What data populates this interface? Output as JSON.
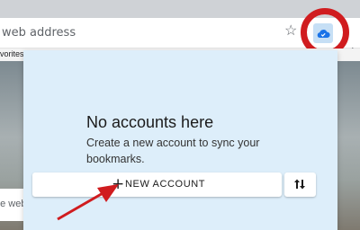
{
  "browser": {
    "address_placeholder": "web address",
    "favorites_label": "vorites",
    "star_icon": "star-icon",
    "extension_icon": "cloud-icon",
    "overflow_icon": "chevron-right-icon"
  },
  "background": {
    "search_text": "ne web"
  },
  "panel": {
    "title": "No accounts here",
    "description": "Create a new account to sync your bookmarks.",
    "new_account_icon": "+",
    "new_account_label": "NEW ACCOUNT",
    "sync_icon": "sync-arrows-icon"
  },
  "colors": {
    "panel_background": "#ddeefa",
    "highlight": "#d01c1f",
    "accent": "#1a73e8"
  }
}
